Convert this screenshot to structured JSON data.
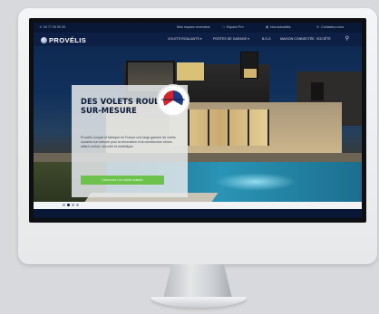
{
  "topbar": {
    "phone": "04 77 20 90 00",
    "links": [
      "Mon espace revendeur",
      "Espace Pro",
      "Nos actualités",
      "Contactez-nous"
    ]
  },
  "nav": {
    "logo": "PROVÉLIS",
    "items": [
      "VOLETS ROULANTS ▾",
      "PORTES DE GARAGE ▾",
      "B.S.O",
      "MAISON CONNECTÉE",
      "SOCIÉTÉ"
    ]
  },
  "hero": {
    "title": "DES VOLETS ROULANTS SUR-MESURE",
    "body": "Provelis conçoit et fabrique en France une large gamme de volets roulants sur-mesure pour la rénovation et la construction neuve, alliant confort, sécurité et esthétique.",
    "cta": "Découvrez nos volets roulants",
    "badge": "ORIGINE FRANCE"
  },
  "slider": {
    "prev": "◀",
    "next": "▶",
    "dots": 4,
    "active_dot": 1
  }
}
